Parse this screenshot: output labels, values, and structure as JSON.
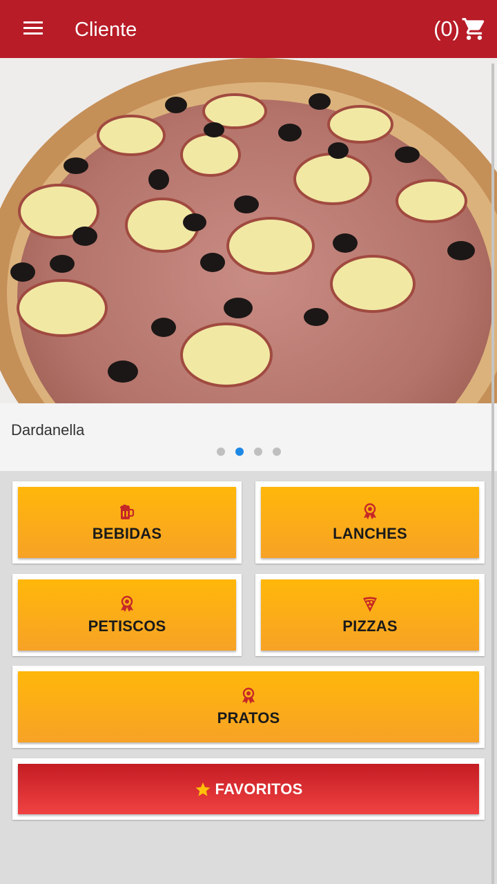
{
  "header": {
    "title": "Cliente",
    "cart_count": "(0)"
  },
  "carousel": {
    "caption": "Dardanella",
    "slide_count": 4,
    "active_slide": 2
  },
  "categories": [
    {
      "label": "BEBIDAS",
      "icon": "beer-mug-icon"
    },
    {
      "label": "LANCHES",
      "icon": "award-ribbon-icon"
    },
    {
      "label": "PETISCOS",
      "icon": "award-ribbon-icon"
    },
    {
      "label": "PIZZAS",
      "icon": "pizza-slice-icon"
    },
    {
      "label": "PRATOS",
      "icon": "award-ribbon-icon"
    }
  ],
  "favorites": {
    "label": "FAVORITOS",
    "icon": "star-icon"
  },
  "colors": {
    "appbar": "#b71c27",
    "category_tile": "#ffb70a",
    "favorites_tile": "#e53935",
    "active_dot": "#1e88e5",
    "icon_red": "#c62828",
    "star": "#ffc107"
  }
}
